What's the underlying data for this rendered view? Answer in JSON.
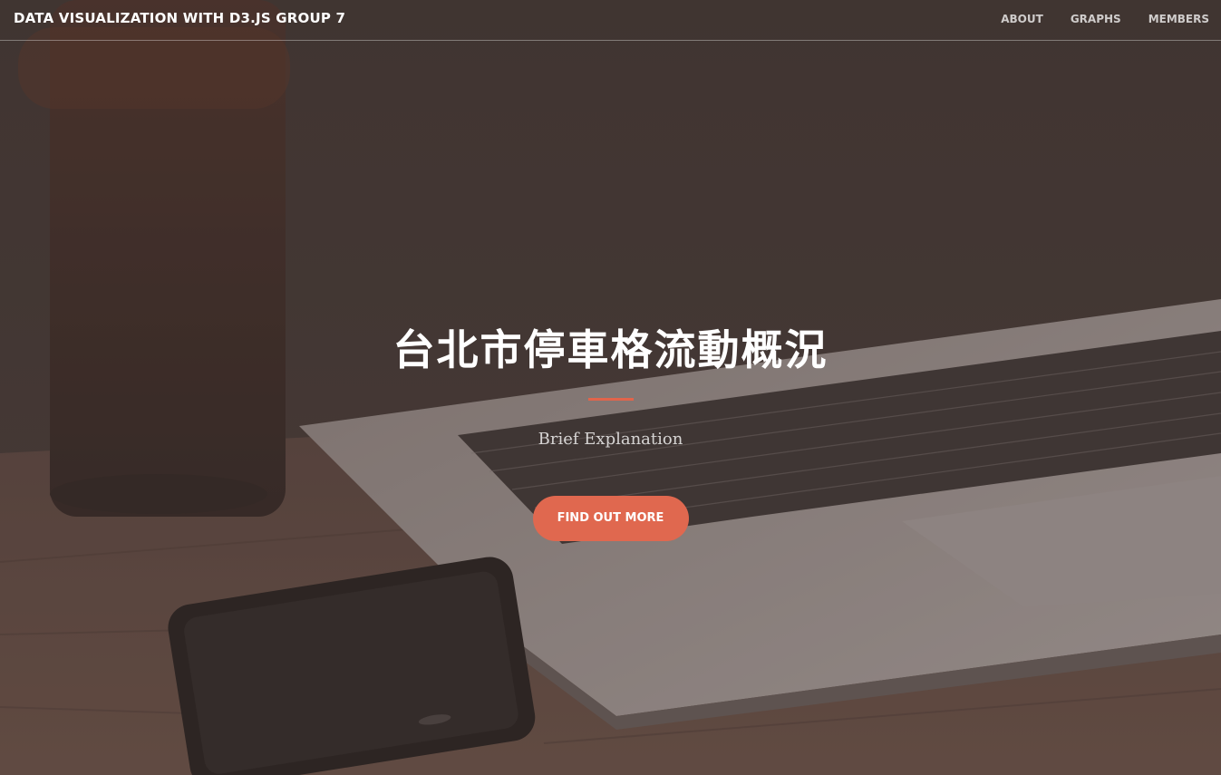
{
  "navbar": {
    "brand": "DATA VISUALIZATION WITH D3.JS GROUP 7",
    "links": [
      {
        "label": "ABOUT"
      },
      {
        "label": "GRAPHS"
      },
      {
        "label": "MEMBERS"
      }
    ]
  },
  "hero": {
    "title": "台北市停車格流動概況",
    "subtitle": "Brief Explanation",
    "cta_label": "FIND OUT MORE"
  },
  "colors": {
    "accent": "#e0684f",
    "overlay": "#483834"
  },
  "icons": {
    "background": "desk-photo-laptop-phone-cup"
  }
}
